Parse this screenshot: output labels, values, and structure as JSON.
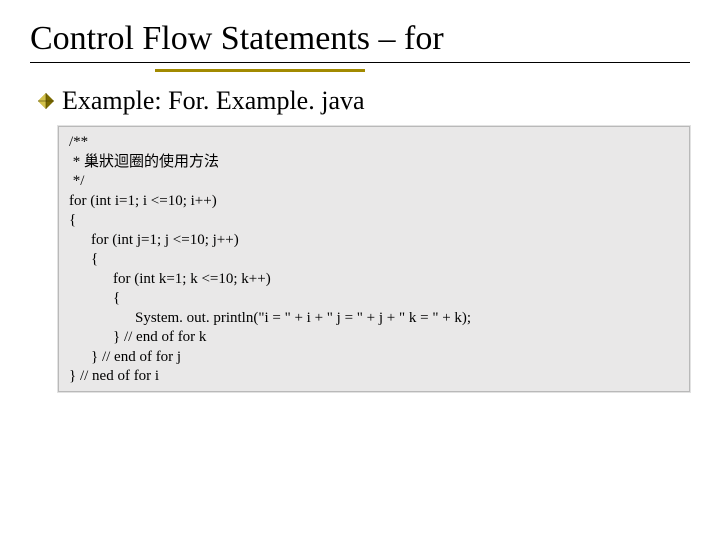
{
  "title": "Control Flow Statements – for",
  "bullet": "Example: For. Example. java",
  "code": {
    "l1": "/**",
    "l2": " * 巢狀迴圈的使用方法",
    "l3": " */",
    "l4": "for (int i=1; i <=10; i++)",
    "l5": "{",
    "l6": "for (int j=1; j <=10; j++)",
    "l7": "{",
    "l8": "for (int k=1; k <=10; k++)",
    "l9": "{",
    "l10": "System. out. println(\"i = \" + i + \" j = \" + j + \" k = \" + k);",
    "l11": "} // end of for k",
    "l12": "} // end of for j",
    "l13": "} // ned of for i"
  }
}
